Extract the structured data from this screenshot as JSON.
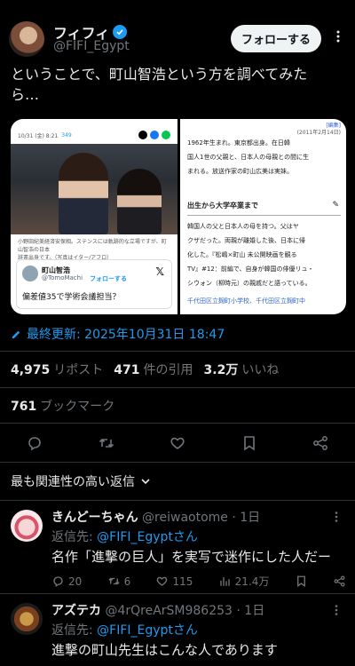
{
  "author": {
    "name": "フィフィ",
    "handle": "@FIFI_Egypt",
    "follow_label": "フォローする"
  },
  "tweet": {
    "text_line1": "ということで、町山智浩という方を調べてみた",
    "text_line2": "ら…"
  },
  "media_left": {
    "top_meta": "10/31 (金) 8:21",
    "top_count": "349",
    "caption_line1": "小野田紀美経済安保相。ステンスには軌跡的な立場ですが、町山智浩の日本",
    "caption_line2": "辞書出身です。（写真はイター/アフロ）",
    "card_name": "町山智浩",
    "card_handle": "@TomoMachi",
    "card_follow": "フォローする",
    "card_text": "偏差値35で学術会議担当？"
  },
  "media_right": {
    "edit_link": "[編集]",
    "date_note": "(2011年2月14日)",
    "line1": "1962年生まれ。東京都出身。在日韓",
    "line2": "国人1世の父親と、日本人の母親との間に生",
    "line3": "まれる。放送作家の町山広美は実妹。",
    "section": "出生から大学卒業まで",
    "s_line1": "韓国人の父と日本人の母を持つ。父はヤ",
    "s_line2": "クザだった。両親が離婚した後、日本に帰",
    "s_line3": "化した。『松嶋×町山 未公開映画を観る",
    "s_line4": "TV』#12：前編で、自身が韓国の俳優リュ・",
    "s_line5": "シウォン（柳時元）の親戚だと語っている。",
    "s_line6": "千代田区立麹町小学校、千代田区立麹町中"
  },
  "edited": {
    "label": "最終更新: 2025年10月31日 18:47"
  },
  "stats": {
    "reposts_num": "4,975",
    "reposts_label": "リポスト",
    "quotes_num": "471",
    "quotes_label": "件の引用",
    "likes_num": "3.2万",
    "likes_label": "いいね",
    "bookmarks_num": "761",
    "bookmarks_label": "ブックマーク"
  },
  "sort": {
    "label": "最も関連性の高い返信"
  },
  "replies": [
    {
      "name": "きんどーちゃん",
      "handle": "@reiwaotome",
      "time": "· 1日",
      "reply_to_prefix": "返信先: ",
      "reply_to": "@FIFI_Egyptさん",
      "text": "名作「進撃の巨人」を実写で迷作にした人だー",
      "replies": "20",
      "reposts": "6",
      "likes": "115",
      "views": "21.4万"
    },
    {
      "name": "アズテカ",
      "handle": "@4rQreArSM986253",
      "time": "· 1日",
      "reply_to_prefix": "返信先: ",
      "reply_to": "@FIFI_Egyptさん",
      "text": "進撃の町山先生はこんな人であります"
    }
  ],
  "colors": {
    "accent": "#1d9bf0",
    "background": "#000000",
    "text": "#e7e9ea",
    "muted": "#71767b"
  }
}
